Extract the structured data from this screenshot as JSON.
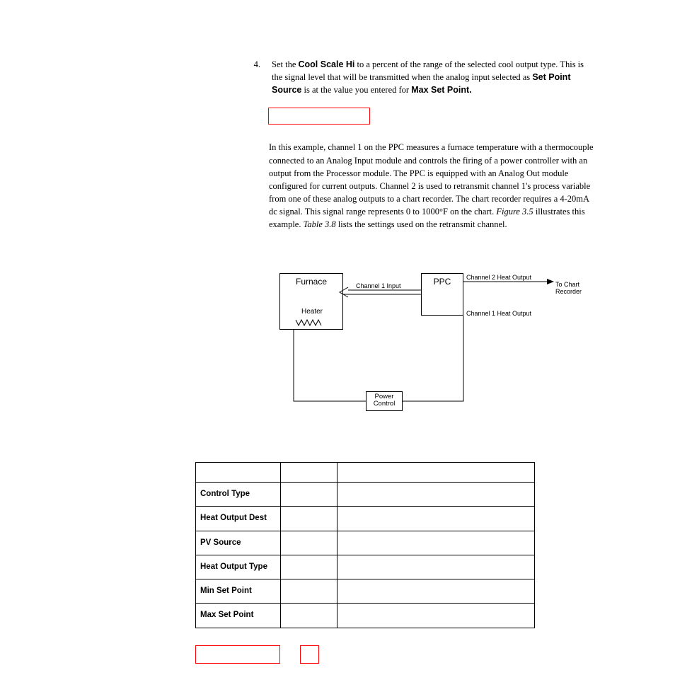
{
  "step": {
    "num": "4.",
    "t1": "Set the ",
    "b1": "Cool Scale Hi",
    "t2": " to a percent of the range of the selected cool output type. This is the signal level that will be trans­mitted when the analog input selected as ",
    "b2": "Set Point Source",
    "t3": " is at the value you entered for ",
    "b3": "Max Set Point."
  },
  "para": {
    "p1": "In this example, channel 1 on the PPC measures a furnace temperature with a thermocouple connected to an Analog Input module and controls the firing of a power controller with an output from the Processor module. The PPC is equipped with an Analog Out module configured for current outputs. Channel 2 is used to retransmit channel 1's process variable from one of these analog outputs to a chart recorder. The chart recorder requires a 4-20mA dc signal. This signal range represents 0 to 1000°F on the chart. ",
    "i1": "Figure 3.5",
    "p2": " illustrates this example. ",
    "i2": "Table 3.8",
    "p3": " lists the settings used on the retransmit channel."
  },
  "diagram": {
    "furnace": "Furnace",
    "heater": "Heater",
    "ppc": "PPC",
    "power_control": "Power\nControl",
    "ch1_input": "Channel 1 Input",
    "ch2_heat": "Channel 2 Heat Output",
    "ch1_heat": "Channel 1 Heat Output",
    "to_chart": "To Chart\nRecorder"
  },
  "table": {
    "rows": [
      {
        "param": "Control Type",
        "val": "",
        "desc": ""
      },
      {
        "param": "Heat Output Dest",
        "val": "",
        "desc": ""
      },
      {
        "param": "PV Source",
        "val": "",
        "desc": ""
      },
      {
        "param": "Heat Output Type",
        "val": "",
        "desc": ""
      },
      {
        "param": "Min Set Point",
        "val": "",
        "desc": ""
      },
      {
        "param": "Max Set Point",
        "val": "",
        "desc": ""
      }
    ]
  }
}
